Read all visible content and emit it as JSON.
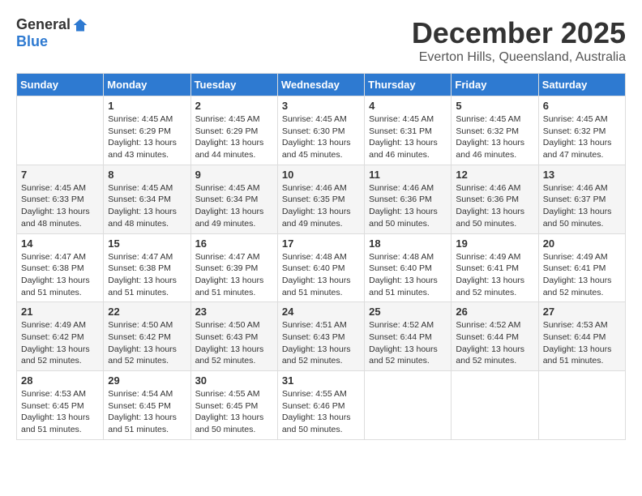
{
  "logo": {
    "general": "General",
    "blue": "Blue"
  },
  "title": {
    "month": "December 2025",
    "location": "Everton Hills, Queensland, Australia"
  },
  "weekdays": [
    "Sunday",
    "Monday",
    "Tuesday",
    "Wednesday",
    "Thursday",
    "Friday",
    "Saturday"
  ],
  "weeks": [
    [
      {
        "day": "",
        "sunrise": "",
        "sunset": "",
        "daylight": ""
      },
      {
        "day": "1",
        "sunrise": "Sunrise: 4:45 AM",
        "sunset": "Sunset: 6:29 PM",
        "daylight": "Daylight: 13 hours and 43 minutes."
      },
      {
        "day": "2",
        "sunrise": "Sunrise: 4:45 AM",
        "sunset": "Sunset: 6:29 PM",
        "daylight": "Daylight: 13 hours and 44 minutes."
      },
      {
        "day": "3",
        "sunrise": "Sunrise: 4:45 AM",
        "sunset": "Sunset: 6:30 PM",
        "daylight": "Daylight: 13 hours and 45 minutes."
      },
      {
        "day": "4",
        "sunrise": "Sunrise: 4:45 AM",
        "sunset": "Sunset: 6:31 PM",
        "daylight": "Daylight: 13 hours and 46 minutes."
      },
      {
        "day": "5",
        "sunrise": "Sunrise: 4:45 AM",
        "sunset": "Sunset: 6:32 PM",
        "daylight": "Daylight: 13 hours and 46 minutes."
      },
      {
        "day": "6",
        "sunrise": "Sunrise: 4:45 AM",
        "sunset": "Sunset: 6:32 PM",
        "daylight": "Daylight: 13 hours and 47 minutes."
      }
    ],
    [
      {
        "day": "7",
        "sunrise": "Sunrise: 4:45 AM",
        "sunset": "Sunset: 6:33 PM",
        "daylight": "Daylight: 13 hours and 48 minutes."
      },
      {
        "day": "8",
        "sunrise": "Sunrise: 4:45 AM",
        "sunset": "Sunset: 6:34 PM",
        "daylight": "Daylight: 13 hours and 48 minutes."
      },
      {
        "day": "9",
        "sunrise": "Sunrise: 4:45 AM",
        "sunset": "Sunset: 6:34 PM",
        "daylight": "Daylight: 13 hours and 49 minutes."
      },
      {
        "day": "10",
        "sunrise": "Sunrise: 4:46 AM",
        "sunset": "Sunset: 6:35 PM",
        "daylight": "Daylight: 13 hours and 49 minutes."
      },
      {
        "day": "11",
        "sunrise": "Sunrise: 4:46 AM",
        "sunset": "Sunset: 6:36 PM",
        "daylight": "Daylight: 13 hours and 50 minutes."
      },
      {
        "day": "12",
        "sunrise": "Sunrise: 4:46 AM",
        "sunset": "Sunset: 6:36 PM",
        "daylight": "Daylight: 13 hours and 50 minutes."
      },
      {
        "day": "13",
        "sunrise": "Sunrise: 4:46 AM",
        "sunset": "Sunset: 6:37 PM",
        "daylight": "Daylight: 13 hours and 50 minutes."
      }
    ],
    [
      {
        "day": "14",
        "sunrise": "Sunrise: 4:47 AM",
        "sunset": "Sunset: 6:38 PM",
        "daylight": "Daylight: 13 hours and 51 minutes."
      },
      {
        "day": "15",
        "sunrise": "Sunrise: 4:47 AM",
        "sunset": "Sunset: 6:38 PM",
        "daylight": "Daylight: 13 hours and 51 minutes."
      },
      {
        "day": "16",
        "sunrise": "Sunrise: 4:47 AM",
        "sunset": "Sunset: 6:39 PM",
        "daylight": "Daylight: 13 hours and 51 minutes."
      },
      {
        "day": "17",
        "sunrise": "Sunrise: 4:48 AM",
        "sunset": "Sunset: 6:40 PM",
        "daylight": "Daylight: 13 hours and 51 minutes."
      },
      {
        "day": "18",
        "sunrise": "Sunrise: 4:48 AM",
        "sunset": "Sunset: 6:40 PM",
        "daylight": "Daylight: 13 hours and 51 minutes."
      },
      {
        "day": "19",
        "sunrise": "Sunrise: 4:49 AM",
        "sunset": "Sunset: 6:41 PM",
        "daylight": "Daylight: 13 hours and 52 minutes."
      },
      {
        "day": "20",
        "sunrise": "Sunrise: 4:49 AM",
        "sunset": "Sunset: 6:41 PM",
        "daylight": "Daylight: 13 hours and 52 minutes."
      }
    ],
    [
      {
        "day": "21",
        "sunrise": "Sunrise: 4:49 AM",
        "sunset": "Sunset: 6:42 PM",
        "daylight": "Daylight: 13 hours and 52 minutes."
      },
      {
        "day": "22",
        "sunrise": "Sunrise: 4:50 AM",
        "sunset": "Sunset: 6:42 PM",
        "daylight": "Daylight: 13 hours and 52 minutes."
      },
      {
        "day": "23",
        "sunrise": "Sunrise: 4:50 AM",
        "sunset": "Sunset: 6:43 PM",
        "daylight": "Daylight: 13 hours and 52 minutes."
      },
      {
        "day": "24",
        "sunrise": "Sunrise: 4:51 AM",
        "sunset": "Sunset: 6:43 PM",
        "daylight": "Daylight: 13 hours and 52 minutes."
      },
      {
        "day": "25",
        "sunrise": "Sunrise: 4:52 AM",
        "sunset": "Sunset: 6:44 PM",
        "daylight": "Daylight: 13 hours and 52 minutes."
      },
      {
        "day": "26",
        "sunrise": "Sunrise: 4:52 AM",
        "sunset": "Sunset: 6:44 PM",
        "daylight": "Daylight: 13 hours and 52 minutes."
      },
      {
        "day": "27",
        "sunrise": "Sunrise: 4:53 AM",
        "sunset": "Sunset: 6:44 PM",
        "daylight": "Daylight: 13 hours and 51 minutes."
      }
    ],
    [
      {
        "day": "28",
        "sunrise": "Sunrise: 4:53 AM",
        "sunset": "Sunset: 6:45 PM",
        "daylight": "Daylight: 13 hours and 51 minutes."
      },
      {
        "day": "29",
        "sunrise": "Sunrise: 4:54 AM",
        "sunset": "Sunset: 6:45 PM",
        "daylight": "Daylight: 13 hours and 51 minutes."
      },
      {
        "day": "30",
        "sunrise": "Sunrise: 4:55 AM",
        "sunset": "Sunset: 6:45 PM",
        "daylight": "Daylight: 13 hours and 50 minutes."
      },
      {
        "day": "31",
        "sunrise": "Sunrise: 4:55 AM",
        "sunset": "Sunset: 6:46 PM",
        "daylight": "Daylight: 13 hours and 50 minutes."
      },
      {
        "day": "",
        "sunrise": "",
        "sunset": "",
        "daylight": ""
      },
      {
        "day": "",
        "sunrise": "",
        "sunset": "",
        "daylight": ""
      },
      {
        "day": "",
        "sunrise": "",
        "sunset": "",
        "daylight": ""
      }
    ]
  ]
}
